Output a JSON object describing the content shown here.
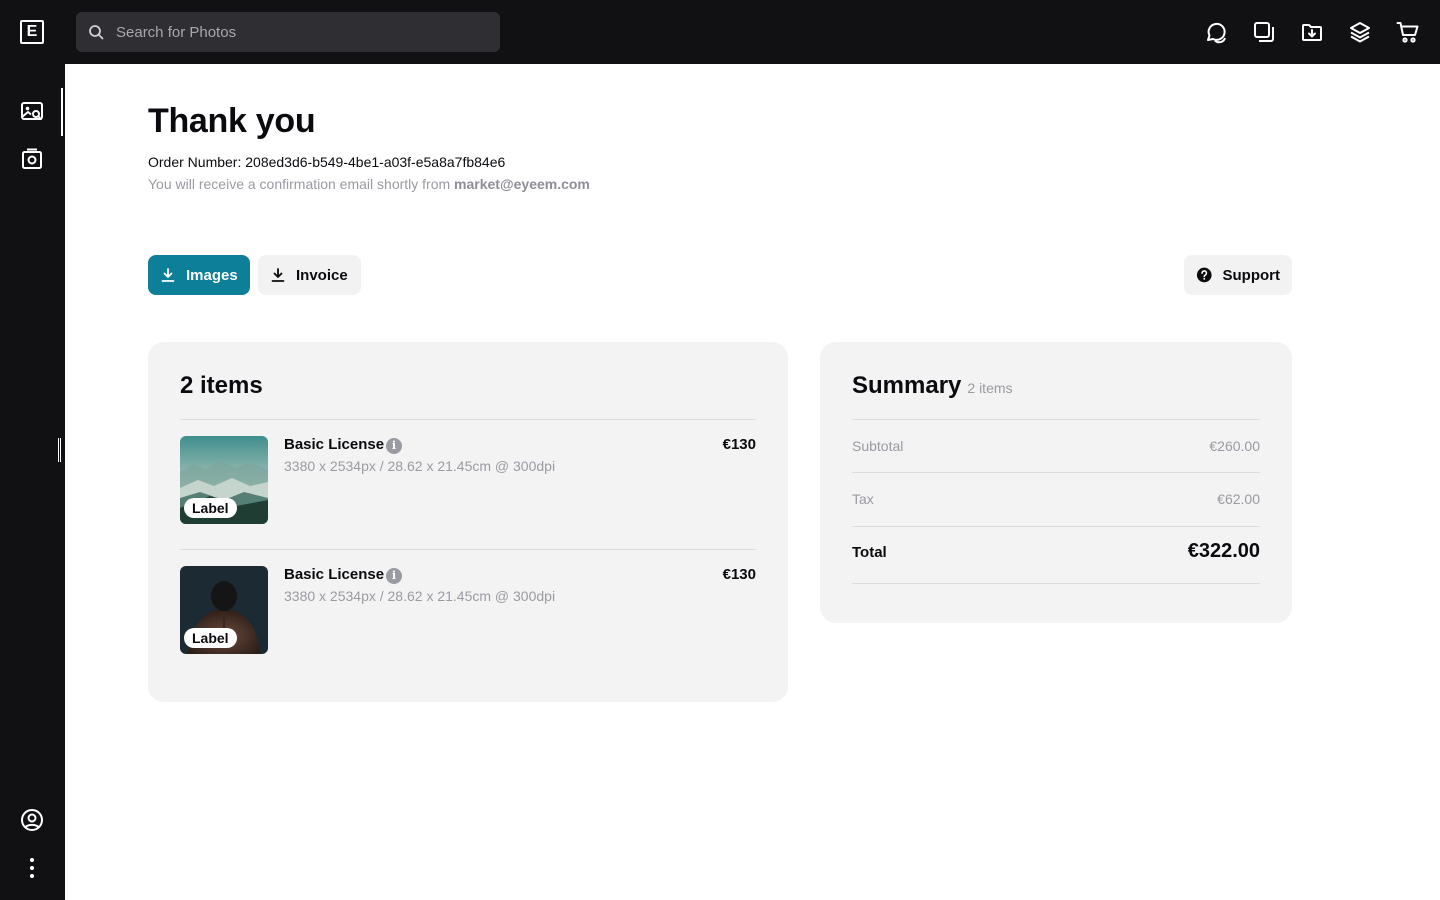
{
  "topbar": {
    "logo": "E",
    "search_placeholder": "Search for Photos",
    "icons": [
      "chat-icon",
      "copy-icon",
      "download-folder-icon",
      "layers-icon",
      "cart-icon"
    ]
  },
  "rail": {
    "icons": [
      "image-search-icon",
      "camera-icon",
      "user-icon",
      "more-icon"
    ]
  },
  "page": {
    "title": "Thank you",
    "order_label": "Order Number: 208ed3d6-b549-4be1-a03f-e5a8a7fb84e6",
    "confirm_text": "You will receive a confirmation email shortly from ",
    "confirm_email": "market@eyeem.com"
  },
  "actions": {
    "images_label": "Images",
    "invoice_label": "Invoice",
    "support_label": "Support"
  },
  "items_card": {
    "title": "2 items",
    "items": [
      {
        "name": "Basic License",
        "spec": "3380 x 2534px / 28.62 x 21.45cm @ 300dpi",
        "price": "€130",
        "badge": "Label"
      },
      {
        "name": "Basic License",
        "spec": "3380 x 2534px / 28.62 x 21.45cm @ 300dpi",
        "price": "€130",
        "badge": "Label"
      }
    ]
  },
  "summary": {
    "title": "Summary",
    "count": "2 items",
    "subtotal_label": "Subtotal",
    "subtotal_value": "€260.00",
    "tax_label": "Tax",
    "tax_value": "€62.00",
    "total_label": "Total",
    "total_value": "€322.00"
  },
  "colors": {
    "accent": "#0e7f98",
    "chrome": "#111114",
    "card": "#f3f3f4"
  }
}
